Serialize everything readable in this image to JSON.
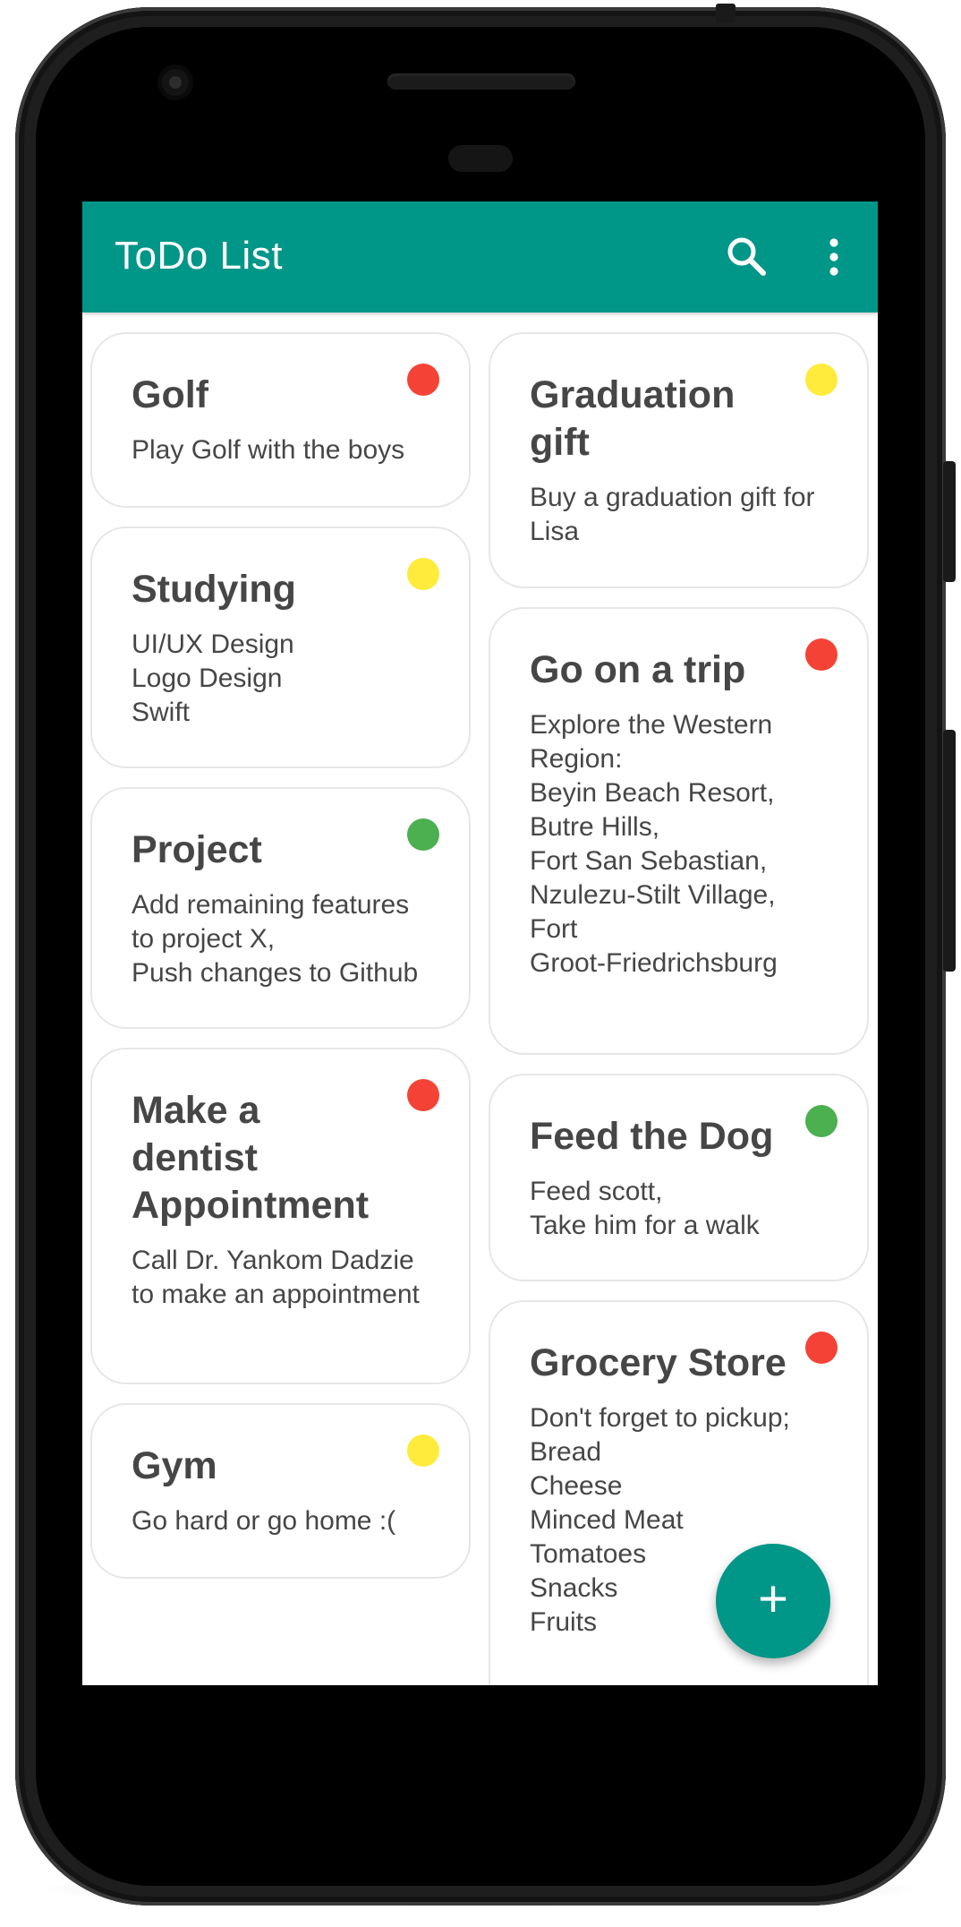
{
  "app": {
    "title": "ToDo List",
    "accent_color": "#009688",
    "actions": [
      {
        "icon": "search-icon"
      },
      {
        "icon": "more-vert-icon"
      }
    ]
  },
  "priority_colors": {
    "high": "#F44336",
    "medium": "#FFEB3B",
    "low": "#4CAF50"
  },
  "notes": {
    "left": [
      {
        "title": "Golf",
        "body": "Play Golf with the boys",
        "priority": "high"
      },
      {
        "title": "Studying",
        "body": "UI/UX Design\nLogo Design\nSwift",
        "priority": "medium"
      },
      {
        "title": "Project",
        "body": "Add remaining features to project X,\nPush changes to Github",
        "priority": "low"
      },
      {
        "title": "Make a dentist Appointment",
        "body": "Call Dr. Yankom Dadzie to make an appointment",
        "priority": "high"
      },
      {
        "title": "Gym",
        "body": "Go hard or go home :(",
        "priority": "medium"
      }
    ],
    "right": [
      {
        "title": "Graduation gift",
        "body": "Buy a graduation gift for Lisa",
        "priority": "medium"
      },
      {
        "title": "Go on a trip",
        "body": "Explore the Western Region:\nBeyin Beach Resort,\nButre Hills,\nFort San Sebastian,\nNzulezu-Stilt Village,\nFort\nGroot-Friedrichsburg",
        "priority": "high"
      },
      {
        "title": "Feed the Dog",
        "body": "Feed scott,\nTake him for a walk",
        "priority": "low"
      },
      {
        "title": "Grocery Store",
        "body": "Don't forget to pickup;\nBread\nCheese\nMinced Meat\nTomatoes\nSnacks\nFruits",
        "priority": "high"
      }
    ]
  },
  "fab": {
    "label": "+",
    "icon": "add-icon"
  }
}
